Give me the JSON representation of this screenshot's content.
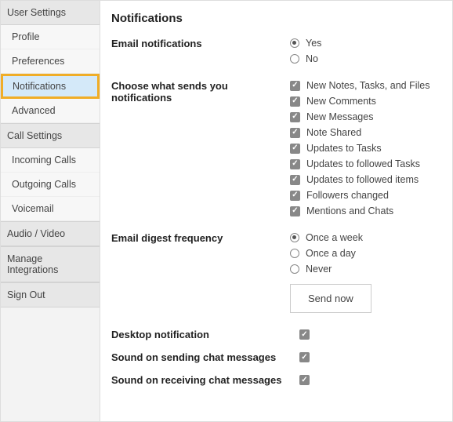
{
  "sidebar": {
    "sections": [
      {
        "header": "User Settings",
        "items": [
          "Profile",
          "Preferences",
          "Notifications",
          "Advanced"
        ],
        "activeIndex": 2
      },
      {
        "header": "Call Settings",
        "items": [
          "Incoming Calls",
          "Outgoing Calls",
          "Voicemail"
        ]
      }
    ],
    "links": [
      "Audio / Video",
      "Manage Integrations",
      "Sign Out"
    ]
  },
  "page": {
    "title": "Notifications",
    "emailNotifications": {
      "label": "Email notifications",
      "options": [
        "Yes",
        "No"
      ],
      "selected": "Yes"
    },
    "chooseWhat": {
      "label": "Choose what sends you notifications",
      "options": [
        "New Notes, Tasks, and Files",
        "New Comments",
        "New Messages",
        "Note Shared",
        "Updates to Tasks",
        "Updates to followed Tasks",
        "Updates to followed items",
        "Followers changed",
        "Mentions and Chats"
      ],
      "checked": [
        true,
        true,
        true,
        true,
        true,
        true,
        true,
        true,
        true
      ]
    },
    "digest": {
      "label": "Email digest frequency",
      "options": [
        "Once a week",
        "Once a day",
        "Never"
      ],
      "selected": "Once a week",
      "button": "Send now"
    },
    "toggles": {
      "desktop": {
        "label": "Desktop notification",
        "checked": true
      },
      "soundSend": {
        "label": "Sound on sending chat messages",
        "checked": true
      },
      "soundRecv": {
        "label": "Sound on receiving chat messages",
        "checked": true
      }
    }
  }
}
